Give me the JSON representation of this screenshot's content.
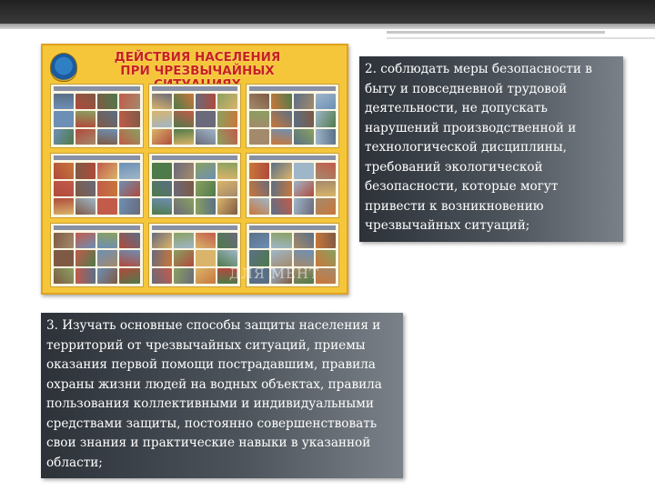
{
  "poster": {
    "title_line1": "ДЕЙСТВИЯ НАСЕЛЕНИЯ",
    "title_line2": "ПРИ ЧРЕЗВЫЧАЙНЫХ СИТУАЦИЯХ",
    "watermark": "ДЛЯ МЕНТ"
  },
  "text_boxes": {
    "right": "2. соблюдать меры безопасности в быту и повседневной трудовой деятельности, не допускать нарушений производственной и технологической дисциплины, требований экологической безопасности, которые могут привести к возникновению чрезвычайных ситуаций;",
    "bottom": "3. Изучать основные способы защиты населения и территорий от чрезвычайных ситуаций, приемы оказания первой помощи пострадавшим, правила охраны жизни людей на водных объектах, правила пользования коллективными и индивидуальными средствами защиты, постоянно совершенствовать свои знания и практические навыки в указанной области;"
  },
  "colors": {
    "poster_background": "#f5c63a",
    "poster_title": "#c8211e",
    "box_dark": "#2d3239",
    "box_light": "#7a8188"
  }
}
